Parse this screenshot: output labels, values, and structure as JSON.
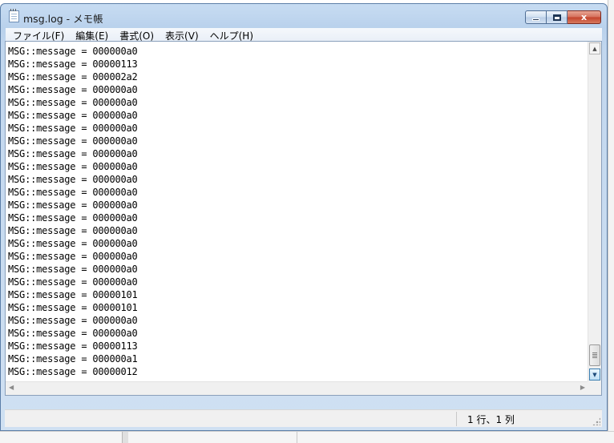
{
  "window": {
    "title": "msg.log - メモ帳",
    "buttons": {
      "minimize": "minimize",
      "maximize": "maximize",
      "close": "x"
    }
  },
  "menu": {
    "items": [
      "ファイル(F)",
      "編集(E)",
      "書式(O)",
      "表示(V)",
      "ヘルプ(H)"
    ]
  },
  "editor": {
    "lines": [
      "MSG::message = 000000a0",
      "MSG::message = 00000113",
      "MSG::message = 000002a2",
      "MSG::message = 000000a0",
      "MSG::message = 000000a0",
      "MSG::message = 000000a0",
      "MSG::message = 000000a0",
      "MSG::message = 000000a0",
      "MSG::message = 000000a0",
      "MSG::message = 000000a0",
      "MSG::message = 000000a0",
      "MSG::message = 000000a0",
      "MSG::message = 000000a0",
      "MSG::message = 000000a0",
      "MSG::message = 000000a0",
      "MSG::message = 000000a0",
      "MSG::message = 000000a0",
      "MSG::message = 000000a0",
      "MSG::message = 000000a0",
      "MSG::message = 00000101",
      "MSG::message = 00000101",
      "MSG::message = 000000a0",
      "MSG::message = 000000a0",
      "MSG::message = 00000113",
      "MSG::message = 000000a1",
      "MSG::message = 00000012"
    ]
  },
  "scroll": {
    "up_icon": "up-arrow-icon",
    "down_icon": "down-arrow-icon",
    "left_icon": "left-arrow-icon",
    "right_icon": "right-arrow-icon"
  },
  "status": {
    "position": "1 行、1 列"
  }
}
